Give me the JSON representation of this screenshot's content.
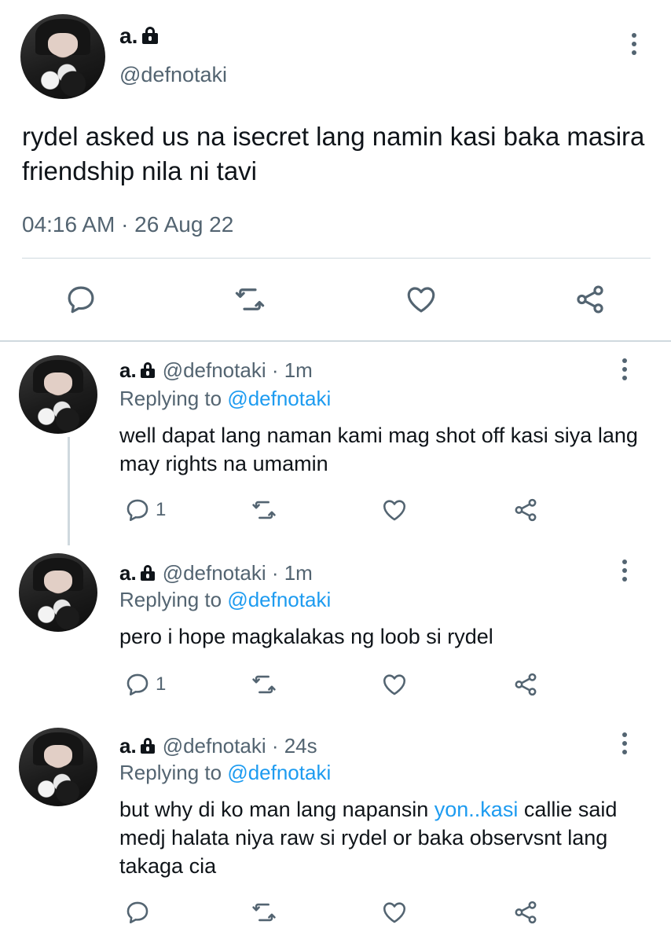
{
  "main_tweet": {
    "display_name": "a.",
    "handle": "@defnotaki",
    "text": "rydel asked us na isecret lang namin kasi baka masira friendship nila ni tavi",
    "meta": "04:16 AM · 26 Aug 22",
    "icons": [
      "reply-icon",
      "retweet-icon",
      "like-icon",
      "share-icon"
    ]
  },
  "replies": [
    {
      "display_name": "a.",
      "handle": "@defnotaki",
      "time": "· 1m",
      "replying_prefix": "Replying to",
      "replying_to": "@defnotaki",
      "text": "well dapat lang naman kami mag shot off kasi siya lang may rights na umamin",
      "reply_count": "1"
    },
    {
      "display_name": "a.",
      "handle": "@defnotaki",
      "time": "· 1m",
      "replying_prefix": "Replying to",
      "replying_to": "@defnotaki",
      "text": "pero i hope magkalakas ng loob si rydel",
      "reply_count": "1"
    },
    {
      "display_name": "a.",
      "handle": "@defnotaki",
      "time": "· 24s",
      "replying_prefix": "Replying to",
      "replying_to": "@defnotaki",
      "text_before": "but why di ko man lang napansin ",
      "text_link": "yon..kasi",
      "text_after": " callie said medj halata niya raw si rydel or baka observsnt lang takaga cia",
      "reply_count": ""
    }
  ],
  "colors": {
    "link": "#1d9bf0",
    "muted": "#536471",
    "text": "#0f1419",
    "border": "#cfd9de"
  }
}
